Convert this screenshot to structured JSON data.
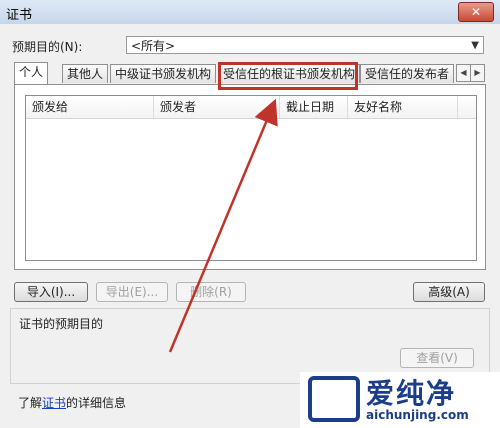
{
  "window": {
    "title": "证书",
    "close_label": "✕"
  },
  "purpose": {
    "label": "预期目的(N):",
    "selected": "<所有>"
  },
  "tabs": [
    {
      "label": "个人"
    },
    {
      "label": "其他人"
    },
    {
      "label": "中级证书颁发机构"
    },
    {
      "label": "受信任的根证书颁发机构"
    },
    {
      "label": "受信任的发布者"
    }
  ],
  "list": {
    "columns": [
      "颁发给",
      "颁发者",
      "截止日期",
      "友好名称"
    ]
  },
  "buttons": {
    "import": "导入(I)...",
    "export": "导出(E)...",
    "remove": "删除(R)",
    "advanced": "高级(A)",
    "view": "查看(V)"
  },
  "purpose_group": {
    "label": "证书的预期目的"
  },
  "footer": {
    "prefix": "了解",
    "link": "证书",
    "suffix": "的详细信息"
  },
  "watermark": {
    "main": "爱纯净",
    "url": "aichunjing.com"
  },
  "colors": {
    "annotation": "#c0332a",
    "link": "#1a3fc1",
    "watermark": "#1c3d8a"
  }
}
